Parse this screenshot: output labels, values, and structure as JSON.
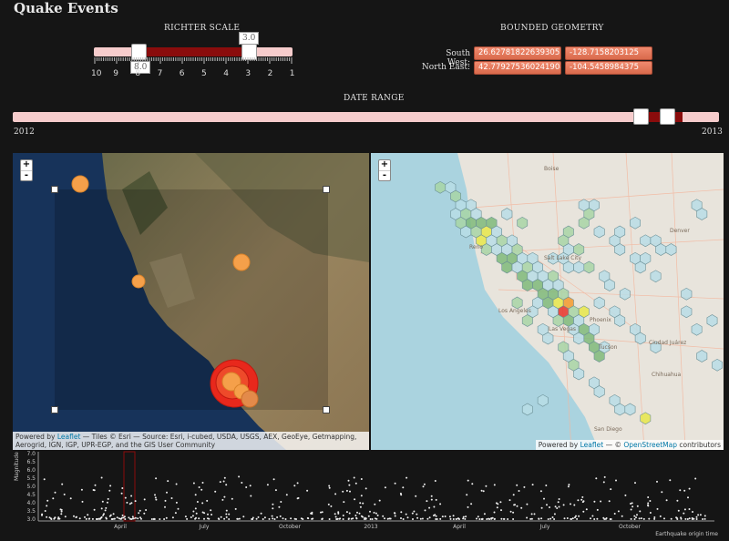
{
  "app": {
    "title": "Quake Events"
  },
  "richter": {
    "label": "RICHTER SCALE",
    "handle_min_label": "8.0",
    "handle_max_label": "3.0",
    "tick_labels": [
      "10",
      "9",
      "8",
      "7",
      "6",
      "5",
      "4",
      "3",
      "2",
      "1"
    ]
  },
  "geometry": {
    "label": "BOUNDED GEOMETRY",
    "south_west": {
      "label": "South West:",
      "lat": "26.62781822639305",
      "lng": "-128.7158203125"
    },
    "north_east": {
      "label": "North East:",
      "lat": "42.779275360241904",
      "lng": "-104.5458984375"
    }
  },
  "date_range": {
    "label": "DATE RANGE",
    "start": "2012",
    "end": "2013"
  },
  "satellite_map": {
    "zoom_in": "+",
    "zoom_out": "-",
    "attribution_prefix": "Powered by ",
    "attribution_link": "Leaflet",
    "attribution_text": " — Tiles © Esri — Source: Esri, i-cubed, USDA, USGS, AEX, GeoEye, Getmapping, Aerogrid, IGN, IGP, UPR-EGP, and the GIS User Community"
  },
  "street_map": {
    "zoom_in": "+",
    "zoom_out": "-",
    "attribution_prefix": "Powered by ",
    "attribution_link": "Leaflet",
    "attribution_mid": " — © ",
    "attribution_link2": "OpenStreetMap",
    "attribution_suffix": " contributors",
    "city_labels": [
      "Boise",
      "Salt Lake City",
      "Reno",
      "Denver",
      "Las Vegas",
      "Phoenix",
      "Tucson",
      "Ciudad Juárez",
      "Chihuahua",
      "San Diego",
      "Los Angeles"
    ]
  },
  "timeline": {
    "y_title": "Magnitude",
    "x_title": "Earthquake origin time",
    "y_ticks": [
      "7.0",
      "6.5",
      "6.0",
      "5.5",
      "5.0",
      "4.5",
      "4.0",
      "3.5",
      "3.0"
    ],
    "x_ticks": [
      "April",
      "July",
      "October",
      "2013",
      "April",
      "July",
      "October"
    ]
  },
  "colors": {
    "background": "#151515",
    "slider_fill": "#8a0c0c",
    "slider_track": "#f6cccc",
    "geo_field": "#e07a5c",
    "quake_small": "#f5a04a",
    "quake_large": "#e8281c"
  }
}
